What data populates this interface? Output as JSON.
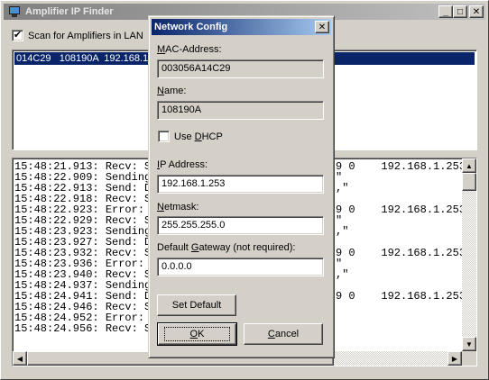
{
  "main_window": {
    "title": "Amplifier IP Finder",
    "minimize": "_",
    "maximize": "□",
    "close": "✕",
    "scan_label": "Scan for Amplifiers in LAN",
    "scan_checked": "✔",
    "list_selected_row": "014C29   108190A  192.168.1."
  },
  "log": {
    "lines_left": [
      "15:48:21.913: Recv: S",
      "15:48:22.909: Sending",
      "15:48:22.913: Send: D",
      "15:48:22.918: Recv: S",
      "15:48:22.923: Error:",
      "15:48:22.929: Recv: S",
      "15:48:23.923: Sending",
      "15:48:23.927: Send: D",
      "15:48:23.932: Recv: S",
      "15:48:23.936: Error:",
      "15:48:23.940: Recv: S",
      "15:48:24.937: Sending",
      "15:48:24.941: Send: D",
      "15:48:24.946: Recv: S",
      "15:48:24.952: Error:",
      "15:48:24.956: Recv: S"
    ],
    "lines_right": [
      "9 0    192.168.1.253",
      "\"",
      ",\"",
      "",
      "9 0    192.168.1.253",
      "\"",
      ",\"",
      "",
      "9 0    192.168.1.253",
      "\"",
      ",\"",
      "",
      "9 0    192.168.1.253"
    ]
  },
  "dialog": {
    "title": "Network Config",
    "close": "✕",
    "mac_label_u": "M",
    "mac_label_rest": "AC-Address:",
    "mac_value": "003056A14C29",
    "name_label_u": "N",
    "name_label_rest": "ame:",
    "name_value": "108190A",
    "dhcp_label_pre": "Use ",
    "dhcp_label_u": "D",
    "dhcp_label_rest": "HCP",
    "ip_label_pre": "",
    "ip_label_u": "I",
    "ip_label_rest": "P Address:",
    "ip_value": "192.168.1.253",
    "netmask_label_u": "N",
    "netmask_label_rest": "etmask:",
    "netmask_value": "255.255.255.0",
    "gateway_label_pre": "Default ",
    "gateway_label_u": "G",
    "gateway_label_rest": "ateway (not required):",
    "gateway_value": "0.0.0.0",
    "set_default_label": "Set Default",
    "ok_label_u": "O",
    "ok_label_rest": "K",
    "cancel_label_u": "C",
    "cancel_label_rest": "ancel"
  }
}
